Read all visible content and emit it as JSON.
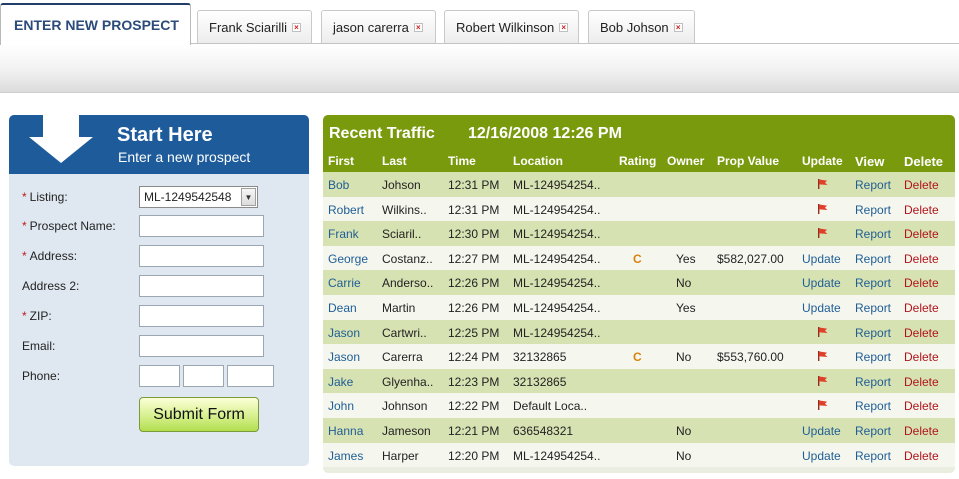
{
  "tabs": {
    "active": "ENTER NEW PROSPECT",
    "others": [
      "Frank Sciarilli",
      "jason carerra",
      "Robert Wilkinson",
      "Bob Johson"
    ],
    "close_glyph": "×"
  },
  "form": {
    "title": "Start Here",
    "subtitle": "Enter a new prospect",
    "listing_label": "Listing:",
    "listing_value": "ML-1249542548",
    "prospect_name_label": "Prospect Name:",
    "address_label": "Address:",
    "address2_label": "Address 2:",
    "zip_label": "ZIP:",
    "email_label": "Email:",
    "phone_label": "Phone:",
    "required_marker": "*",
    "submit_label": "Submit Form"
  },
  "traffic": {
    "title": "Recent Traffic",
    "datetime": "12/16/2008 12:26 PM",
    "columns": [
      "First",
      "Last",
      "Time",
      "Location",
      "Rating",
      "Owner",
      "Prop Value",
      "Update",
      "View",
      "Delete"
    ],
    "rows": [
      {
        "first": "Bob",
        "last": "Johson",
        "time": "12:31 PM",
        "location": "ML-124954254..",
        "rating": "",
        "owner": "",
        "prop": "",
        "update": "flag",
        "view": "Report",
        "delete": "Delete"
      },
      {
        "first": "Robert",
        "last": "Wilkins..",
        "time": "12:31 PM",
        "location": "ML-124954254..",
        "rating": "",
        "owner": "",
        "prop": "",
        "update": "flag",
        "view": "Report",
        "delete": "Delete"
      },
      {
        "first": "Frank",
        "last": "Sciaril..",
        "time": "12:30 PM",
        "location": "ML-124954254..",
        "rating": "",
        "owner": "",
        "prop": "",
        "update": "flag",
        "view": "Report",
        "delete": "Delete"
      },
      {
        "first": "George",
        "last": "Costanz..",
        "time": "12:27 PM",
        "location": "ML-124954254..",
        "rating": "C",
        "owner": "Yes",
        "prop": "$582,027.00",
        "update": "Update",
        "view": "Report",
        "delete": "Delete"
      },
      {
        "first": "Carrie",
        "last": "Anderso..",
        "time": "12:26 PM",
        "location": "ML-124954254..",
        "rating": "",
        "owner": "No",
        "prop": "",
        "update": "Update",
        "view": "Report",
        "delete": "Delete"
      },
      {
        "first": "Dean",
        "last": "Martin",
        "time": "12:26 PM",
        "location": "ML-124954254..",
        "rating": "",
        "owner": "Yes",
        "prop": "",
        "update": "Update",
        "view": "Report",
        "delete": "Delete"
      },
      {
        "first": "Jason",
        "last": "Cartwri..",
        "time": "12:25 PM",
        "location": "ML-124954254..",
        "rating": "",
        "owner": "",
        "prop": "",
        "update": "flag",
        "view": "Report",
        "delete": "Delete"
      },
      {
        "first": "Jason",
        "last": "Carerra",
        "time": "12:24 PM",
        "location": "32132865",
        "rating": "C",
        "owner": "No",
        "prop": "$553,760.00",
        "update": "flag",
        "view": "Report",
        "delete": "Delete"
      },
      {
        "first": "Jake",
        "last": "Glyenha..",
        "time": "12:23 PM",
        "location": "32132865",
        "rating": "",
        "owner": "",
        "prop": "",
        "update": "flag",
        "view": "Report",
        "delete": "Delete"
      },
      {
        "first": "John",
        "last": "Johnson",
        "time": "12:22 PM",
        "location": "Default Loca..",
        "rating": "",
        "owner": "",
        "prop": "",
        "update": "flag",
        "view": "Report",
        "delete": "Delete"
      },
      {
        "first": "Hanna",
        "last": "Jameson",
        "time": "12:21 PM",
        "location": "636548321",
        "rating": "",
        "owner": "No",
        "prop": "",
        "update": "Update",
        "view": "Report",
        "delete": "Delete"
      },
      {
        "first": "James",
        "last": "Harper",
        "time": "12:20 PM",
        "location": "ML-124954254..",
        "rating": "",
        "owner": "No",
        "prop": "",
        "update": "Update",
        "view": "Report",
        "delete": "Delete"
      }
    ]
  }
}
